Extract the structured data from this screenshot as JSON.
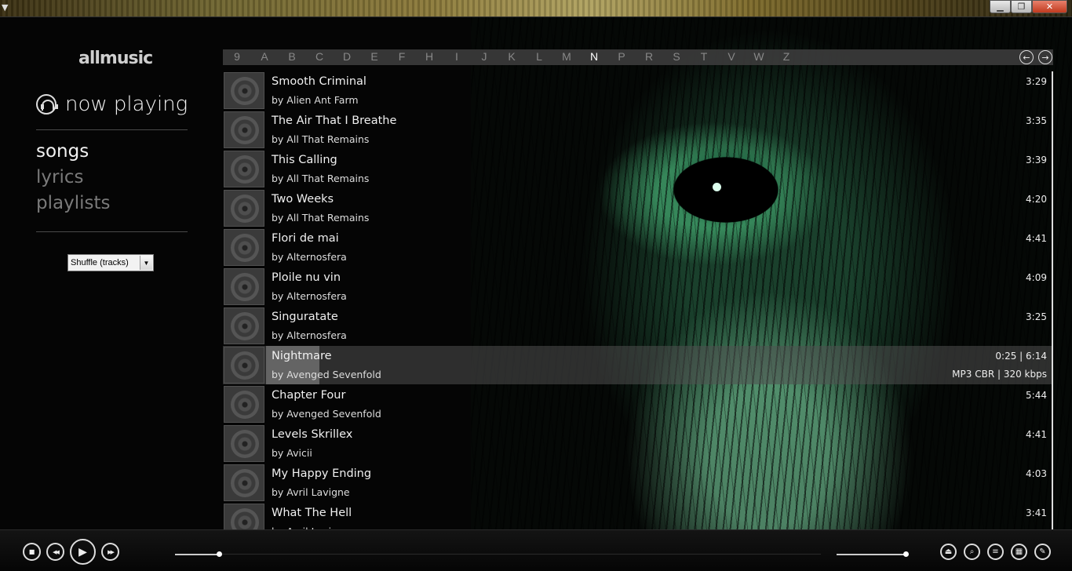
{
  "window": {
    "controls": {
      "minimize": "▁",
      "maximize": "❐",
      "close": "✕"
    }
  },
  "sidebar": {
    "brand": "allmusic",
    "now_playing": "now playing",
    "nav": [
      {
        "label": "songs",
        "active": true
      },
      {
        "label": "lyrics",
        "active": false
      },
      {
        "label": "playlists",
        "active": false
      }
    ],
    "shuffle": {
      "selected": "Shuffle (tracks)"
    }
  },
  "alphabet": {
    "letters": [
      "9",
      "A",
      "B",
      "C",
      "D",
      "E",
      "F",
      "H",
      "I",
      "J",
      "K",
      "L",
      "M",
      "N",
      "P",
      "R",
      "S",
      "T",
      "V",
      "W",
      "Z"
    ],
    "current": "N"
  },
  "songs": [
    {
      "title": "Smooth Criminal",
      "artist": "by Alien Ant Farm",
      "duration": "3:29"
    },
    {
      "title": "The Air That I Breathe",
      "artist": "by All That Remains",
      "duration": "3:35"
    },
    {
      "title": "This Calling",
      "artist": "by All That Remains",
      "duration": "3:39"
    },
    {
      "title": "Two Weeks",
      "artist": "by All That Remains",
      "duration": "4:20"
    },
    {
      "title": "Flori de mai",
      "artist": "by Alternosfera",
      "duration": "4:41"
    },
    {
      "title": "Ploile nu vin",
      "artist": "by Alternosfera",
      "duration": "4:09"
    },
    {
      "title": "Singuratate",
      "artist": "by Alternosfera",
      "duration": "3:25"
    },
    {
      "title": "Nightmare",
      "artist": "by Avenged Sevenfold",
      "duration": "0:25  |  6:14",
      "format": "MP3 CBR | 320 kbps",
      "playing": true,
      "progress": 0.068
    },
    {
      "title": "Chapter Four",
      "artist": "by Avenged Sevenfold",
      "duration": "5:44"
    },
    {
      "title": "Levels Skrillex",
      "artist": "by Avicii",
      "duration": "4:41"
    },
    {
      "title": "My Happy Ending",
      "artist": "by Avril Lavigne",
      "duration": "4:03"
    },
    {
      "title": "What The Hell",
      "artist": "by Avril Lavigne",
      "duration": "3:41"
    }
  ],
  "transport": {
    "position_fraction": 0.068,
    "volume_fraction": 0.97,
    "buttons": {
      "stop": "■",
      "prev": "◀◀",
      "play": "▶",
      "next": "▶▶"
    },
    "tools": {
      "eject": "⏏",
      "search": "⌕",
      "equalizer": "≡",
      "visualizer": "▦",
      "settings": "✎"
    }
  }
}
